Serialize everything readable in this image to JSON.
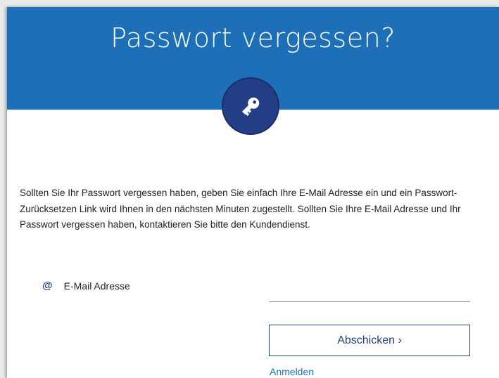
{
  "header": {
    "title": "Passwort vergessen?",
    "background_color": "#1d70b7",
    "icon": "key-icon",
    "icon_circle_color": "#233e84"
  },
  "main": {
    "description": "Sollten Sie Ihr Passwort vergessen haben, geben Sie einfach Ihre E-Mail Adresse ein und ein Passwort-Zurücksetzen Link wird Ihnen in den nächsten Minuten zugestellt. Sollten Sie Ihre E-Mail Adresse und Ihr Passwort vergessen haben, kontaktieren Sie bitte den Kundendienst.",
    "email_icon": "@",
    "email_label": "E-Mail Adresse",
    "email_value": "",
    "submit_label": "Abschicken ›",
    "login_link": "Anmelden"
  }
}
